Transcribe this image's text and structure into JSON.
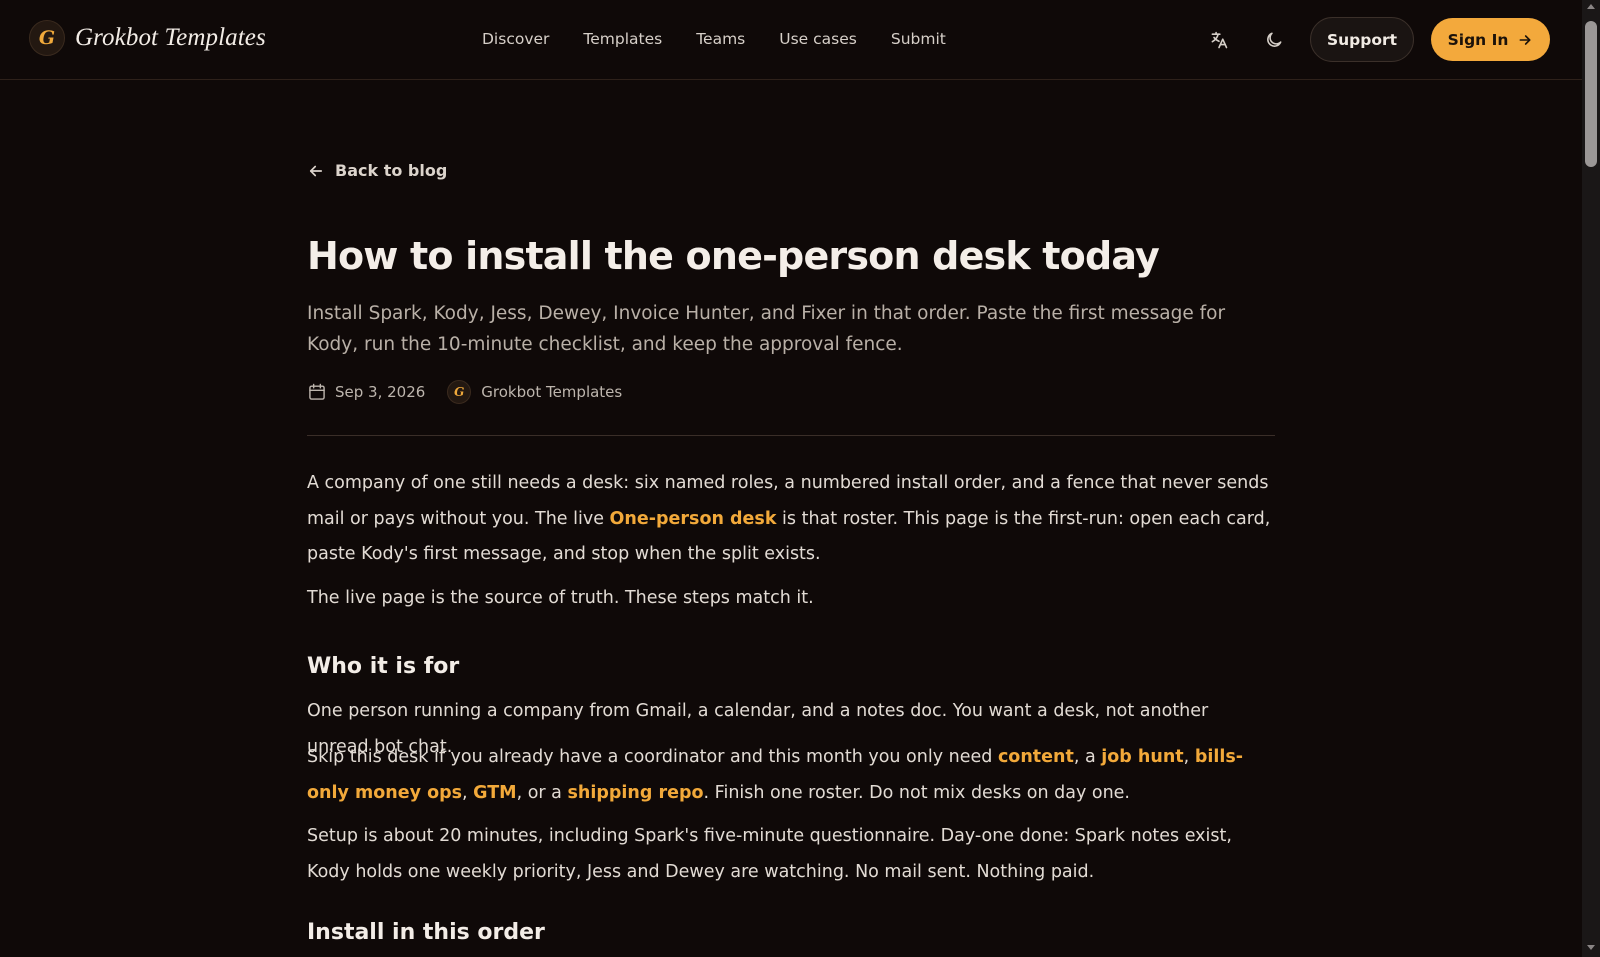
{
  "header": {
    "brand_initial": "G",
    "brand_name": "Grokbot Templates",
    "nav": [
      "Discover",
      "Templates",
      "Teams",
      "Use cases",
      "Submit"
    ],
    "translate_icon": "translate-icon",
    "theme_icon": "moon-icon",
    "support_label": "Support",
    "signin_label": "Sign In"
  },
  "article": {
    "back_label": "Back to blog",
    "title": "How to install the one-person desk today",
    "subtitle": "Install Spark, Kody, Jess, Dewey, Invoice Hunter, and Fixer in that order. Paste the first message for Kody, run the 10-minute checklist, and keep the approval fence.",
    "date": "Sep 3, 2026",
    "author_initial": "G",
    "author": "Grokbot Templates",
    "p1": {
      "before": "A company of one still needs a desk: six named roles, a numbered install order, and a fence that never sends mail or pays without you. The live ",
      "link": "One-person desk",
      "after": " is that roster. This page is the first-run: open each card, paste Kody's first message, and stop when the split exists."
    },
    "p2": "The live page is the source of truth. These steps match it.",
    "h_who": "Who it is for",
    "p3": "One person running a company from Gmail, a calendar, and a notes doc. You want a desk, not another unread bot chat.",
    "p4": {
      "t1": "Skip this desk if you already have a coordinator and this month you only need ",
      "l1": "content",
      "t2": ", a ",
      "l2": "job hunt",
      "t3": ", ",
      "l3": "bills-only money ops",
      "t4": ", ",
      "l4": "GTM",
      "t5": ", or a ",
      "l5": "shipping repo",
      "t6": ". Finish one roster. Do not mix desks on day one."
    },
    "p5": "Setup is about 20 minutes, including Spark's five-minute questionnaire. Day-one done: Spark notes exist, Kody holds one weekly priority, Jess and Dewey are watching. No mail sent. Nothing paid.",
    "h_install": "Install in this order"
  },
  "colors": {
    "accent": "#f3a93c",
    "background": "#0f0908",
    "link": "#f2a93a"
  }
}
